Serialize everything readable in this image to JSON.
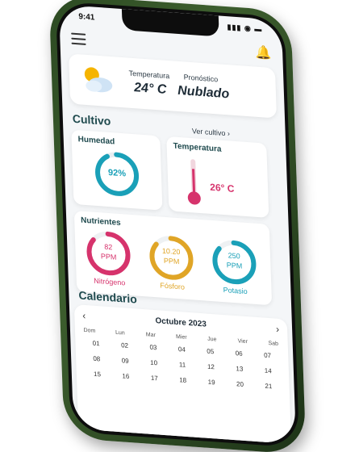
{
  "status": {
    "time": "9:41"
  },
  "weather": {
    "temp_label": "Temperatura",
    "temp_value": "24° C",
    "forecast_label": "Pronóstico",
    "forecast_value": "Nublado"
  },
  "cultivo": {
    "title": "Cultivo",
    "link": "Ver cultivo",
    "humedad": {
      "title": "Humedad",
      "value": "92%",
      "level": 0.92
    },
    "temperatura": {
      "title": "Temperatura",
      "value": "26° C"
    }
  },
  "nutrientes": {
    "title": "Nutrientes",
    "items": [
      {
        "value": "82",
        "unit": "PPM",
        "name": "Nitrógeno",
        "color": "#d6336c"
      },
      {
        "value": "10.20",
        "unit": "PPM",
        "name": "Fósforo",
        "color": "#e0a526"
      },
      {
        "value": "250",
        "unit": "PPM",
        "name": "Potasio",
        "color": "#1aa0b8"
      }
    ]
  },
  "calendario": {
    "title": "Calendario",
    "month": "Octubre 2023",
    "weekdays": [
      "Dom",
      "Lun",
      "Mar",
      "Mier",
      "Jue",
      "Vier",
      "Sab"
    ],
    "dates": [
      "01",
      "02",
      "03",
      "04",
      "05",
      "06",
      "07",
      "08",
      "09",
      "10",
      "11",
      "12",
      "13",
      "14",
      "15",
      "16",
      "17",
      "18",
      "19",
      "20",
      "21"
    ]
  },
  "colors": {
    "accent": "#1f4a4e",
    "humidity": "#1aa0b8",
    "temperature": "#d6336c"
  }
}
